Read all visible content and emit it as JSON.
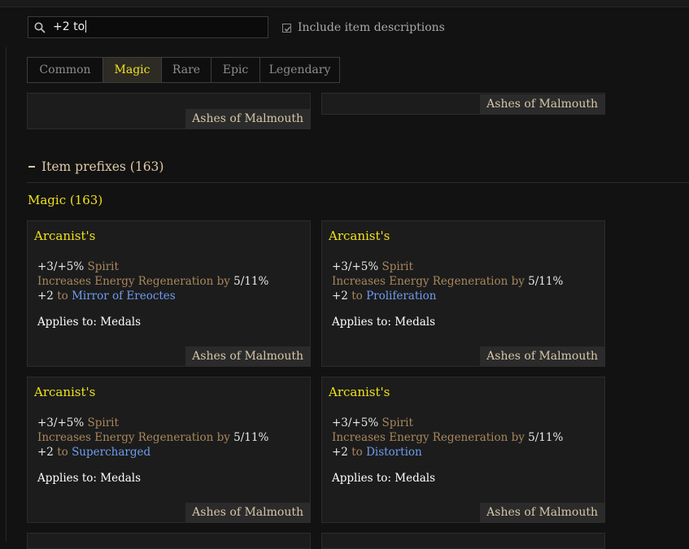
{
  "search": {
    "value": "+2 to"
  },
  "include_descriptions": {
    "label": "Include item descriptions",
    "checked": true
  },
  "tabs": [
    {
      "label": "Common"
    },
    {
      "label": "Magic",
      "active": true
    },
    {
      "label": "Rare"
    },
    {
      "label": "Epic"
    },
    {
      "label": "Legendary"
    }
  ],
  "prev_cards": [
    {
      "source": "Ashes of Malmouth"
    },
    {
      "source": "Ashes of Malmouth"
    }
  ],
  "section": {
    "title": "Item prefixes (163)"
  },
  "group": {
    "title": "Magic (163)"
  },
  "cards": [
    {
      "title": "Arcanist's",
      "spirit_value": "+3/+5%",
      "spirit_label": "Spirit",
      "regen_label": "Increases Energy Regeneration by",
      "regen_value": "5/11%",
      "skill_bonus": "+2",
      "skill_to": "to",
      "skill": "Mirror of Ereoctes",
      "applies": "Applies to: Medals",
      "source": "Ashes of Malmouth"
    },
    {
      "title": "Arcanist's",
      "spirit_value": "+3/+5%",
      "spirit_label": "Spirit",
      "regen_label": "Increases Energy Regeneration by",
      "regen_value": "5/11%",
      "skill_bonus": "+2",
      "skill_to": "to",
      "skill": "Proliferation",
      "applies": "Applies to: Medals",
      "source": "Ashes of Malmouth"
    },
    {
      "title": "Arcanist's",
      "spirit_value": "+3/+5%",
      "spirit_label": "Spirit",
      "regen_label": "Increases Energy Regeneration by",
      "regen_value": "5/11%",
      "skill_bonus": "+2",
      "skill_to": "to",
      "skill": "Supercharged",
      "applies": "Applies to: Medals",
      "source": "Ashes of Malmouth"
    },
    {
      "title": "Arcanist's",
      "spirit_value": "+3/+5%",
      "spirit_label": "Spirit",
      "regen_label": "Increases Energy Regeneration by",
      "regen_value": "5/11%",
      "skill_bonus": "+2",
      "skill_to": "to",
      "skill": "Distortion",
      "applies": "Applies to: Medals",
      "source": "Ashes of Malmouth"
    }
  ],
  "colors": {
    "accent_yellow": "#f1e21c",
    "stat_tan": "#a8875c",
    "skill_blue": "#6e9df0",
    "background": "#121212",
    "card": "#1c1c1c"
  }
}
